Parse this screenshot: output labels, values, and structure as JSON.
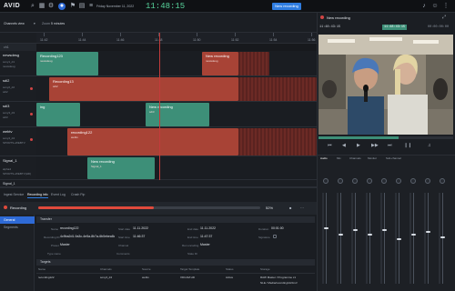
{
  "app": {
    "logo": "AVID",
    "date": "Friday November 11, 2022",
    "clock": "11:48:15",
    "new_recording_label": "New recording"
  },
  "timeline": {
    "view_label": "Channels view",
    "zoom_label": "Zoom",
    "zoom_value": "5 minutes",
    "ticks": [
      "11:42",
      "11:44",
      "11:46",
      "11:48",
      "11:50",
      "11:52",
      "11:54",
      "11:56"
    ],
    "section_label": "ch1",
    "channels": [
      {
        "name": "newsdesg",
        "meta1": "sony1_d1",
        "meta2": "newsdesg"
      },
      {
        "name": "sdi2",
        "meta1": "sony2_d2",
        "meta2": "sdi2"
      },
      {
        "name": "sdi3",
        "meta1": "sony3_d3",
        "meta2": "sdi3"
      },
      {
        "name": "webtv",
        "meta1": "sony4_d4",
        "meta2": "SPORTS+WEBTV"
      },
      {
        "name": "Signal_1",
        "meta1": "alpha4",
        "meta2": "SPORTS+WEBTV(HD)"
      }
    ],
    "signal_label": "Signal_1",
    "clips": [
      {
        "title": "Recording123",
        "sub": "newsdesg"
      },
      {
        "title": "New recording",
        "sub": "newsdesg"
      },
      {
        "title": "Recording13",
        "sub": "sdi2"
      },
      {
        "title": "ing",
        "sub": "sdi3"
      },
      {
        "title": "New recording",
        "sub": "sdi3"
      },
      {
        "title": "recording122",
        "sub": "webtv"
      },
      {
        "title": "New recording",
        "sub": "Signal_1"
      }
    ]
  },
  "preview": {
    "title": "New recording",
    "timecode_left": "11:48:43:15",
    "timecode_mid": "11:48:43:15",
    "timecode_right": "00:00:00:00",
    "controls": [
      "⏮",
      "◀",
      "▶",
      "▶▶",
      "⏭",
      "❙❙"
    ]
  },
  "mixer": {
    "tabs": [
      "Audio",
      "Mix",
      "Channels",
      "Monitor",
      "Sub-channel"
    ],
    "levels": [
      0.62,
      0.55,
      0.6,
      0.55,
      0.6,
      0.5,
      0.55,
      0.58,
      0.52
    ]
  },
  "bottom": {
    "tabs": [
      "Ingest Service",
      "Recording info",
      "Event Log",
      "Crash Ftp"
    ],
    "status_label": "Recording",
    "progress_pct": "52%",
    "progress": 0.52,
    "nav": [
      "General",
      "Segments"
    ],
    "transfer_head": "Transfer",
    "fields": {
      "name_lbl": "Name",
      "name_val": "recording122",
      "start_lbl": "Start date",
      "start_val": "11.11.2022",
      "end_lbl": "End date",
      "end_val": "11.11.2022",
      "dur_lbl": "Duration",
      "dur_val": "00:01:00",
      "recid_lbl": "Recording ID",
      "recid_val": "4c9ba2d1-9a3c-4e5a-8b7a-6b0ebea8c",
      "st_lbl": "Start time",
      "st_val": "11:46:37",
      "et_lbl": "End time",
      "et_val": "11:47:37",
      "sig_lbl": "Signature",
      "sig_val": "",
      "preset_lbl": "Preset",
      "preset_val": "Master",
      "chset_lbl": "Channel",
      "chset_val": "",
      "fmt_lbl": "Rec encoding",
      "fmt_val": "Master",
      "type_lbl": "Type name",
      "type_val": "",
      "comment_lbl": "Comments",
      "comment_val": "",
      "state_lbl": "State ID",
      "state_val": ""
    },
    "targets_head": "Targets",
    "table_headers": [
      "Name",
      "Channels",
      "Source",
      "Target Template",
      "Status",
      "Storage"
    ],
    "rows": [
      [
        "recording122",
        "sony4_d4",
        "webtv",
        "XDCAM HD",
        "Active",
        "RAW Master / Programme x1"
      ],
      [
        "",
        "",
        "",
        "",
        "",
        "NLE / Media/recording122/mxf"
      ]
    ]
  }
}
